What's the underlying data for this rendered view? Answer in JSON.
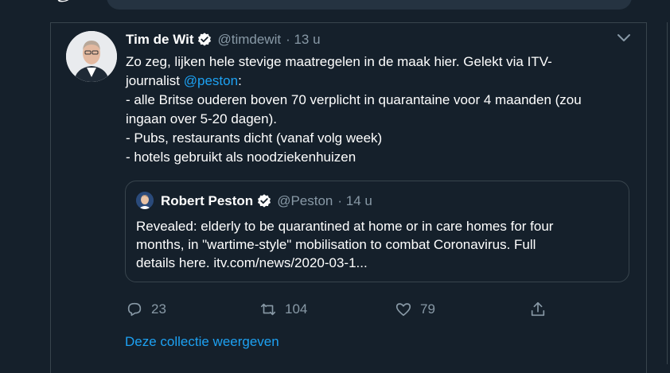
{
  "tweet": {
    "author_name": "Tim de Wit",
    "author_handle": "@timdewit",
    "time": "· 13 u",
    "text_line1": "Zo zeg, lijken hele stevige maatregelen in de maak hier. Gelekt via ITV-",
    "text_line2_prefix": "journalist ",
    "mention": "@peston",
    "text_line2_suffix": ":",
    "text_line3": "- alle Britse ouderen boven 70 verplicht in quarantaine voor 4 maanden (zou",
    "text_line4": "ingaan over 5-20 dagen).",
    "text_line5": "- Pubs, restaurants dicht (vanaf volg week)",
    "text_line6": "- hotels gebruikt als noodziekenhuizen"
  },
  "quote": {
    "author_name": "Robert Peston",
    "author_handle": "@Peston",
    "time": "· 14 u",
    "text_line1": "Revealed: elderly to be quarantined at home or in care homes for four",
    "text_line2": "months, in \"wartime-style\" mobilisation to combat Coronavirus. Full",
    "text_line3": "details here. itv.com/news/2020-03-1..."
  },
  "actions": {
    "reply_count": "23",
    "retweet_count": "104",
    "like_count": "79"
  },
  "collection_link": "Deze collectie weergeven",
  "icons": [
    "verified-badge-icon",
    "chevron-down-icon",
    "reply-icon",
    "retweet-icon",
    "like-icon",
    "share-icon"
  ],
  "colors": {
    "background": "#15202b",
    "accent": "#1da1f2",
    "muted": "#8899a6",
    "border": "#38444d"
  }
}
